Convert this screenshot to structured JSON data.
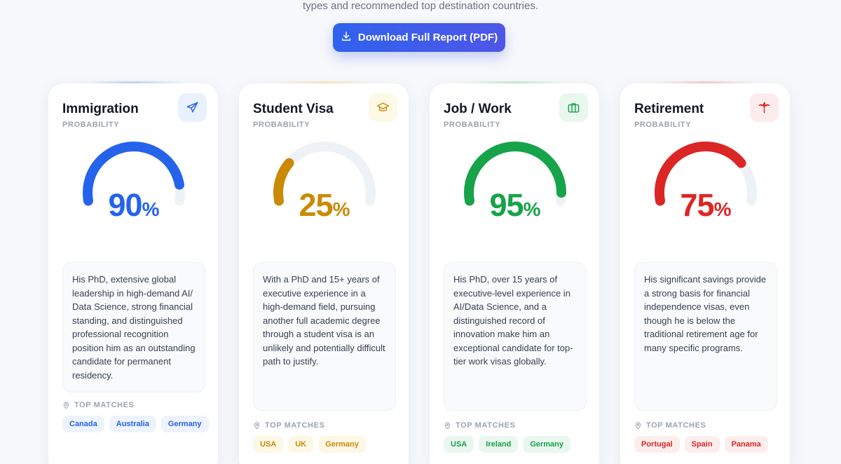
{
  "header": {
    "subtitle": "types and recommended top destination countries.",
    "download_label": "Download Full Report (PDF)"
  },
  "colors": {
    "blue": "#2563eb",
    "gold": "#ca8a04",
    "green": "#16a34a",
    "red": "#dc2626"
  },
  "cards": [
    {
      "title": "Immigration",
      "subtitle": "PROBABILITY",
      "icon": "plane-icon",
      "value": 90,
      "percent_sign": "%",
      "description": "His PhD, extensive global leadership in high-demand AI/ Data Science, strong financial standing, and distinguished professional recognition position him as an outstanding candidate for permanent residency.",
      "matches_label": "TOP MATCHES",
      "matches": [
        "Canada",
        "Australia",
        "Germany"
      ]
    },
    {
      "title": "Student Visa",
      "subtitle": "PROBABILITY",
      "icon": "graduation-cap-icon",
      "value": 25,
      "percent_sign": "%",
      "description": "With a PhD and 15+ years of executive experience in a high-demand field, pursuing another full academic degree through a student visa is an unlikely and potentially difficult path to justify.",
      "matches_label": "TOP MATCHES",
      "matches": [
        "USA",
        "UK",
        "Germany"
      ]
    },
    {
      "title": "Job / Work",
      "subtitle": "PROBABILITY",
      "icon": "briefcase-icon",
      "value": 95,
      "percent_sign": "%",
      "description": "His PhD, over 15 years of executive-level experience in AI/Data Science, and a distinguished record of innovation make him an exceptional candidate for top-tier work visas globally.",
      "matches_label": "TOP MATCHES",
      "matches": [
        "USA",
        "Ireland",
        "Germany"
      ]
    },
    {
      "title": "Retirement",
      "subtitle": "PROBABILITY",
      "icon": "palm-tree-icon",
      "value": 75,
      "percent_sign": "%",
      "description": "His significant savings provide a strong basis for financial independence visas, even though he is below the traditional retirement age for many specific programs.",
      "matches_label": "TOP MATCHES",
      "matches": [
        "Portugal",
        "Spain",
        "Panama"
      ]
    }
  ]
}
